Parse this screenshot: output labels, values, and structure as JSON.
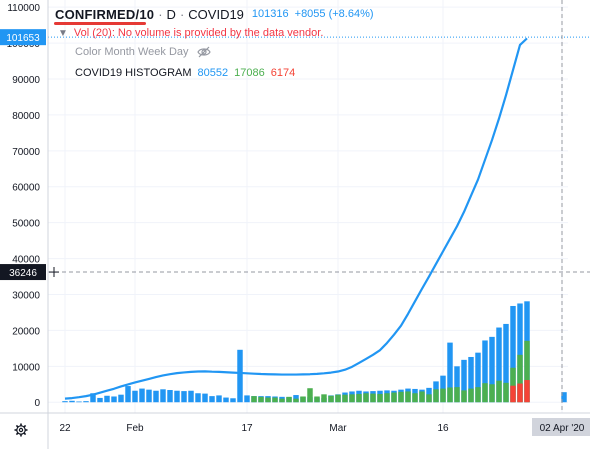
{
  "header": {
    "symbol": "CONFIRMED/10",
    "interval": "D",
    "source": "COVID19",
    "last_price": "101316",
    "change": "+8055 (+8.64%)"
  },
  "volume_notice": "Vol (20): No volume is provided by the data vendor.",
  "legend": {
    "study_name": "Color Month Week Day",
    "histogram_name": "COVID19 HISTOGRAM",
    "hist_values": [
      "80552",
      "17086",
      "6174"
    ]
  },
  "price_scale": {
    "current_label": "101653",
    "crosshair_label": "36246"
  },
  "colors": {
    "line": "#2196f3",
    "blue_bar": "#2196f3",
    "green_bar": "#4caf50",
    "red_bar": "#f44336",
    "underline": "#e53935",
    "notice": "#f23645",
    "badge_bg": "#2196f3"
  },
  "chart_data": {
    "type": "bar",
    "description_axes": "daily time axis from 2020-01-22 to 2020-04-02",
    "ylim": [
      -3000,
      112000
    ],
    "x_ticks": [
      "22",
      "Feb",
      "17",
      "Mar",
      "16",
      "02 Apr '20"
    ],
    "x_tick_dates": [
      "2020-01-22",
      "2020-02-01",
      "2020-02-17",
      "2020-03-01",
      "2020-03-16",
      "2020-04-02"
    ],
    "y_ticks": [
      0,
      10000,
      20000,
      30000,
      40000,
      50000,
      60000,
      70000,
      80000,
      90000,
      100000,
      110000
    ],
    "start_date": "2020-01-22",
    "line": [
      1000,
      1150,
      1400,
      1700,
      2100,
      2650,
      3200,
      3750,
      4400,
      4950,
      5500,
      6000,
      6500,
      7000,
      7450,
      7800,
      8100,
      8300,
      8450,
      8550,
      8600,
      8500,
      8450,
      8350,
      8250,
      8150,
      8050,
      7950,
      7850,
      7800,
      7750,
      7700,
      7700,
      7700,
      7750,
      7800,
      7900,
      8050,
      8250,
      8550,
      9050,
      9850,
      10950,
      12050,
      13200,
      14500,
      16500,
      18800,
      21300,
      24600,
      28100,
      31600,
      35000,
      38500,
      42000,
      45500,
      49000,
      53000,
      57500,
      62000,
      67500,
      73000,
      79000,
      85500,
      92500,
      99500,
      101316
    ],
    "blue_bars": [
      300,
      400,
      200,
      300,
      2500,
      1200,
      1800,
      1600,
      2100,
      4500,
      3200,
      3800,
      3500,
      3200,
      3600,
      3400,
      3200,
      3100,
      3200,
      2500,
      2400,
      1700,
      1900,
      1300,
      1100,
      14600,
      1900,
      1700,
      1700,
      1700,
      1600,
      1500,
      1400,
      2000,
      1500,
      1400,
      1300,
      1200,
      1900,
      2200,
      2700,
      3000,
      3200,
      3000,
      3100,
      3200,
      3300,
      3200,
      3500,
      3800,
      3700,
      3500,
      4000,
      5800,
      7400,
      16600,
      10000,
      11800,
      12600,
      13800,
      17200,
      18200,
      20800,
      21800,
      26800,
      27500,
      28100
    ],
    "green_bars": [
      0,
      0,
      0,
      0,
      0,
      0,
      0,
      0,
      0,
      0,
      0,
      0,
      0,
      0,
      0,
      0,
      0,
      0,
      0,
      0,
      0,
      0,
      0,
      0,
      0,
      0,
      0,
      1700,
      1500,
      1300,
      1300,
      1000,
      1500,
      1000,
      1600,
      3900,
      1600,
      2200,
      1800,
      2100,
      2100,
      2200,
      2300,
      2500,
      2400,
      2300,
      2500,
      2700,
      2900,
      3000,
      2500,
      3000,
      2200,
      3600,
      3800,
      4100,
      4200,
      3300,
      3800,
      4200,
      5300,
      5000,
      6000,
      5400,
      9600,
      13200,
      17086
    ],
    "red_bars": [
      0,
      0,
      0,
      0,
      0,
      0,
      0,
      0,
      0,
      0,
      0,
      0,
      0,
      0,
      0,
      0,
      0,
      0,
      0,
      0,
      0,
      0,
      0,
      0,
      0,
      0,
      0,
      0,
      0,
      0,
      0,
      0,
      0,
      0,
      0,
      0,
      0,
      0,
      0,
      0,
      0,
      0,
      0,
      0,
      0,
      0,
      0,
      0,
      0,
      0,
      0,
      0,
      0,
      0,
      0,
      0,
      0,
      0,
      0,
      0,
      0,
      0,
      0,
      0,
      4600,
      5200,
      6174
    ],
    "right_edge": [
      0,
      0,
      2800
    ],
    "blue_top_label_value": 80552
  }
}
